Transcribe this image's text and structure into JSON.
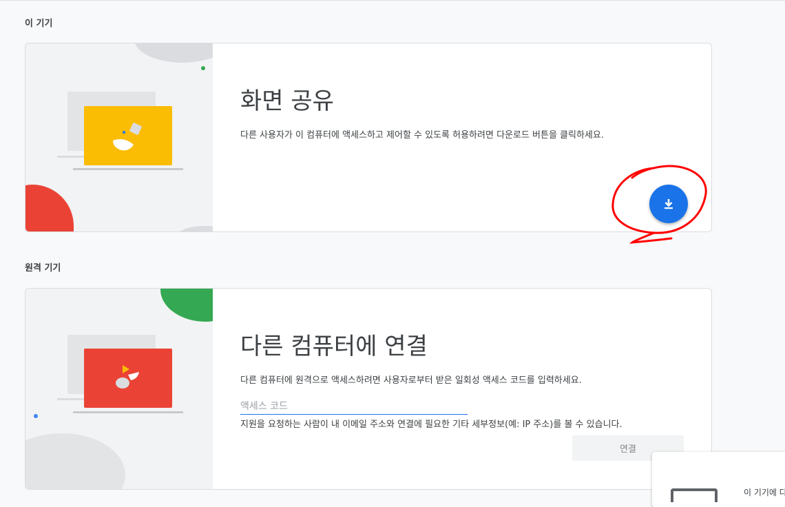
{
  "sections": {
    "this_device": {
      "label": "이 기기"
    },
    "remote_device": {
      "label": "원격 기기"
    }
  },
  "share_card": {
    "title": "화면 공유",
    "description": "다른 사용자가 이 컴퓨터에 액세스하고 제어할 수 있도록 허용하려면 다운로드 버튼을 클릭하세요.",
    "download_icon": "download-icon",
    "accent_color": "#1a73e8"
  },
  "connect_card": {
    "title": "다른 컴퓨터에 연결",
    "description": "다른 컴퓨터에 원격으로 액세스하려면 사용자로부터 받은 일회성 액세스 코드를 입력하세요.",
    "code_input": {
      "placeholder": "액세스 코드",
      "value": ""
    },
    "notice": "지원을 요청하는 사람이 내 이메일 주소와 연결에 필요한 기타 세부정보(예: IP 주소)를 볼 수 있습니다.",
    "connect_label": "연결"
  },
  "toast": {
    "text": "이 기기에 다"
  },
  "colors": {
    "yellow": "#fbbc04",
    "red": "#ea4335",
    "green": "#34a853",
    "blue": "#1a73e8",
    "annotation": "#ff0000"
  }
}
